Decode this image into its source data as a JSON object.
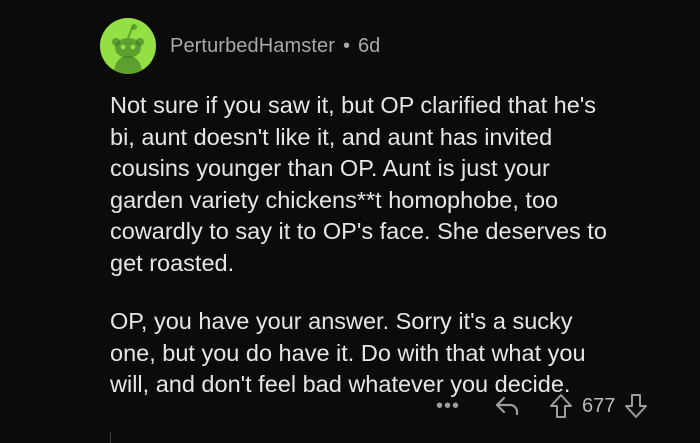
{
  "comment": {
    "author": "PerturbedHamster",
    "separator": "•",
    "age": "6d",
    "paragraphs": [
      "Not sure if you saw it, but OP clarified that he's\nbi, aunt doesn't like it, and aunt has invited\ncousins younger than OP.  Aunt is just your\ngarden variety chickens**t homophobe, too\ncowardly to say it to OP's face.  She deserves to\nget roasted.",
      "OP, you have your answer.  Sorry it's a sucky\none, but you do have it.  Do with that what you\nwill, and don't feel bad whatever you decide."
    ]
  },
  "actions": {
    "more_label": "•••",
    "vote_count": "677",
    "more_icon": "ellipsis-icon",
    "reply_icon": "reply-arrow-icon",
    "upvote_icon": "upvote-arrow-icon",
    "downvote_icon": "downvote-arrow-icon"
  },
  "colors": {
    "background": "#0b0b0b",
    "avatar": "#94e044",
    "text": "#e4e6e8",
    "meta": "#a7a9ab"
  }
}
